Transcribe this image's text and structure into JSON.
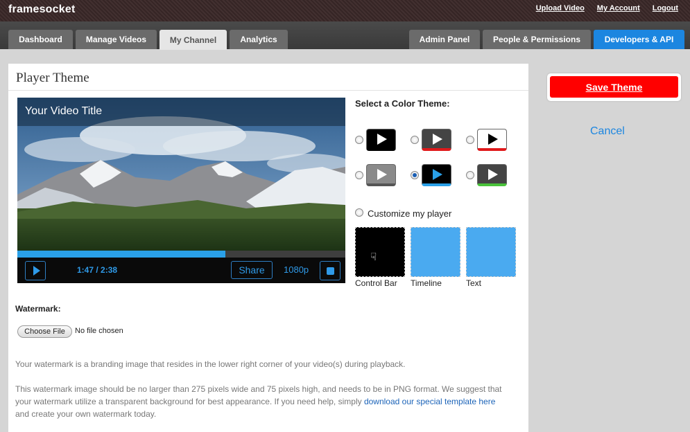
{
  "brand": {
    "logo": "framesocket"
  },
  "top_links": [
    "Upload Video",
    "My Account",
    "Logout"
  ],
  "nav": {
    "left_tabs": [
      "Dashboard",
      "Manage Videos",
      "My Channel",
      "Analytics"
    ],
    "right_tabs": [
      "Admin Panel",
      "People & Permissions",
      "Developers & API"
    ],
    "active_tab": "My Channel"
  },
  "panel": {
    "title": "Player Theme"
  },
  "player": {
    "video_title": "Your Video Title",
    "time": "1:47 / 2:38",
    "progress": 0.635,
    "share_label": "Share",
    "resolution": "1080p"
  },
  "themes": {
    "title": "Select a Color Theme:",
    "selected_index": 4,
    "options": [
      {
        "bg": "#ffffff",
        "screen": "#000000",
        "play": "#ffffff",
        "bar": "#000000"
      },
      {
        "bg": "#ffffff",
        "screen": "#444444",
        "play": "#ffffff",
        "bar": "#e0191b"
      },
      {
        "bg": "#ffffff",
        "screen": "#ffffff",
        "play": "#000000",
        "bar": "#e0191b"
      },
      {
        "bg": "#ffffff",
        "screen": "#8a8a8a",
        "play": "#ffffff",
        "bar": "#555555"
      },
      {
        "bg": "#ffffff",
        "screen": "#000000",
        "play": "#2aa0e8",
        "bar": "#2aa0e8"
      },
      {
        "bg": "#ffffff",
        "screen": "#444444",
        "play": "#ffffff",
        "bar": "#49c23a"
      }
    ],
    "customize_label": "Customize my player"
  },
  "swatches": [
    {
      "label": "Control Bar",
      "color": "#000000"
    },
    {
      "label": "Timeline",
      "color": "#4aaaf0"
    },
    {
      "label": "Text",
      "color": "#4aaaf0"
    }
  ],
  "watermark": {
    "title": "Watermark:",
    "choose_file": "Choose File",
    "no_file": "No file chosen",
    "para1": "Your watermark is a branding image that resides in the lower right corner of your video(s) during playback.",
    "para2_a": "This watermark image should be no larger than 275 pixels wide and 75 pixels high, and needs to be in PNG format. We suggest that your watermark utilize a transparent background for best appearance. If you need help, simply ",
    "para2_link": "download our special template here",
    "para2_b": " and create your own watermark today."
  },
  "actions": {
    "save": "Save Theme",
    "cancel": "Cancel"
  }
}
